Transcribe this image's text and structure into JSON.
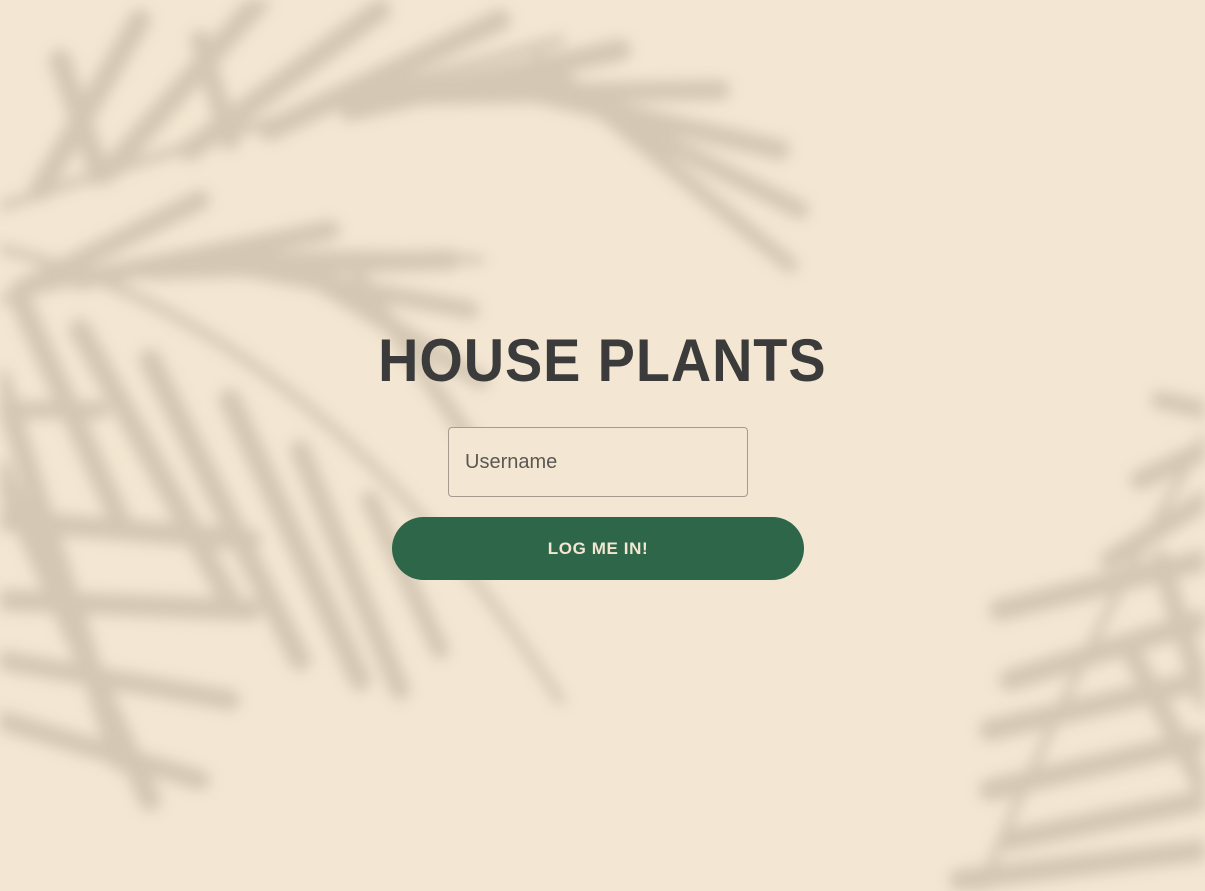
{
  "page": {
    "title": "HOUSE PLANTS"
  },
  "login_form": {
    "username_placeholder": "Username",
    "username_value": "",
    "submit_label": "LOG ME IN!"
  },
  "colors": {
    "background": "#f3e6d2",
    "title_text": "#3b3b3b",
    "button_background": "#2e6649",
    "button_text": "#f3e6d2",
    "input_border": "#a59c8f",
    "leaf_shadow": "#cbbfac"
  },
  "decoration": {
    "background_motif": "palm-leaf-shadows"
  }
}
